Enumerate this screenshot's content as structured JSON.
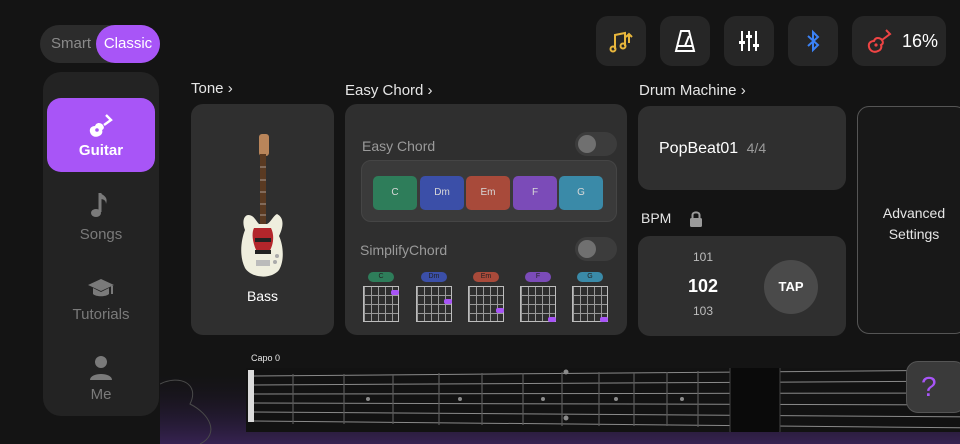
{
  "mode_toggle": {
    "smart": "Smart",
    "classic": "Classic"
  },
  "toolbar": {
    "icons": [
      "music-note-up-icon",
      "metronome-icon",
      "mixer-sliders-icon",
      "bluetooth-icon",
      "guitar-icon"
    ],
    "battery_percent": "16%"
  },
  "sidebar": {
    "items": [
      {
        "label": "Guitar",
        "icon": "guitar-icon"
      },
      {
        "label": "Songs",
        "icon": "music-note-icon"
      },
      {
        "label": "Tutorials",
        "icon": "graduation-cap-icon"
      },
      {
        "label": "Me",
        "icon": "person-icon"
      }
    ]
  },
  "tone": {
    "title": "Tone",
    "instrument": "Bass"
  },
  "easy_chord": {
    "title": "Easy Chord",
    "toggle_label": "Easy Chord",
    "chords": [
      "C",
      "Dm",
      "Em",
      "F",
      "G"
    ],
    "simplify_label": "SimplifyChord",
    "mini_chords": [
      "C",
      "Dm",
      "Em",
      "F",
      "G"
    ]
  },
  "drum_machine": {
    "title": "Drum Machine",
    "pattern": "PopBeat01",
    "signature": "4/4",
    "bpm_label": "BPM",
    "bpm_prev": "101",
    "bpm_current": "102",
    "bpm_next": "103",
    "tap_label": "TAP"
  },
  "advanced": {
    "line1": "Advanced",
    "line2": "Settings"
  },
  "fretboard": {
    "capo_label": "Capo 0"
  },
  "help": {
    "label": "?"
  },
  "colors": {
    "accent": "#a855f7",
    "chord_c": "#2e7d5a",
    "chord_dm": "#3b4fa8",
    "chord_em": "#a84a3a",
    "chord_f": "#7b4bb8",
    "chord_g": "#3a8aa8"
  }
}
